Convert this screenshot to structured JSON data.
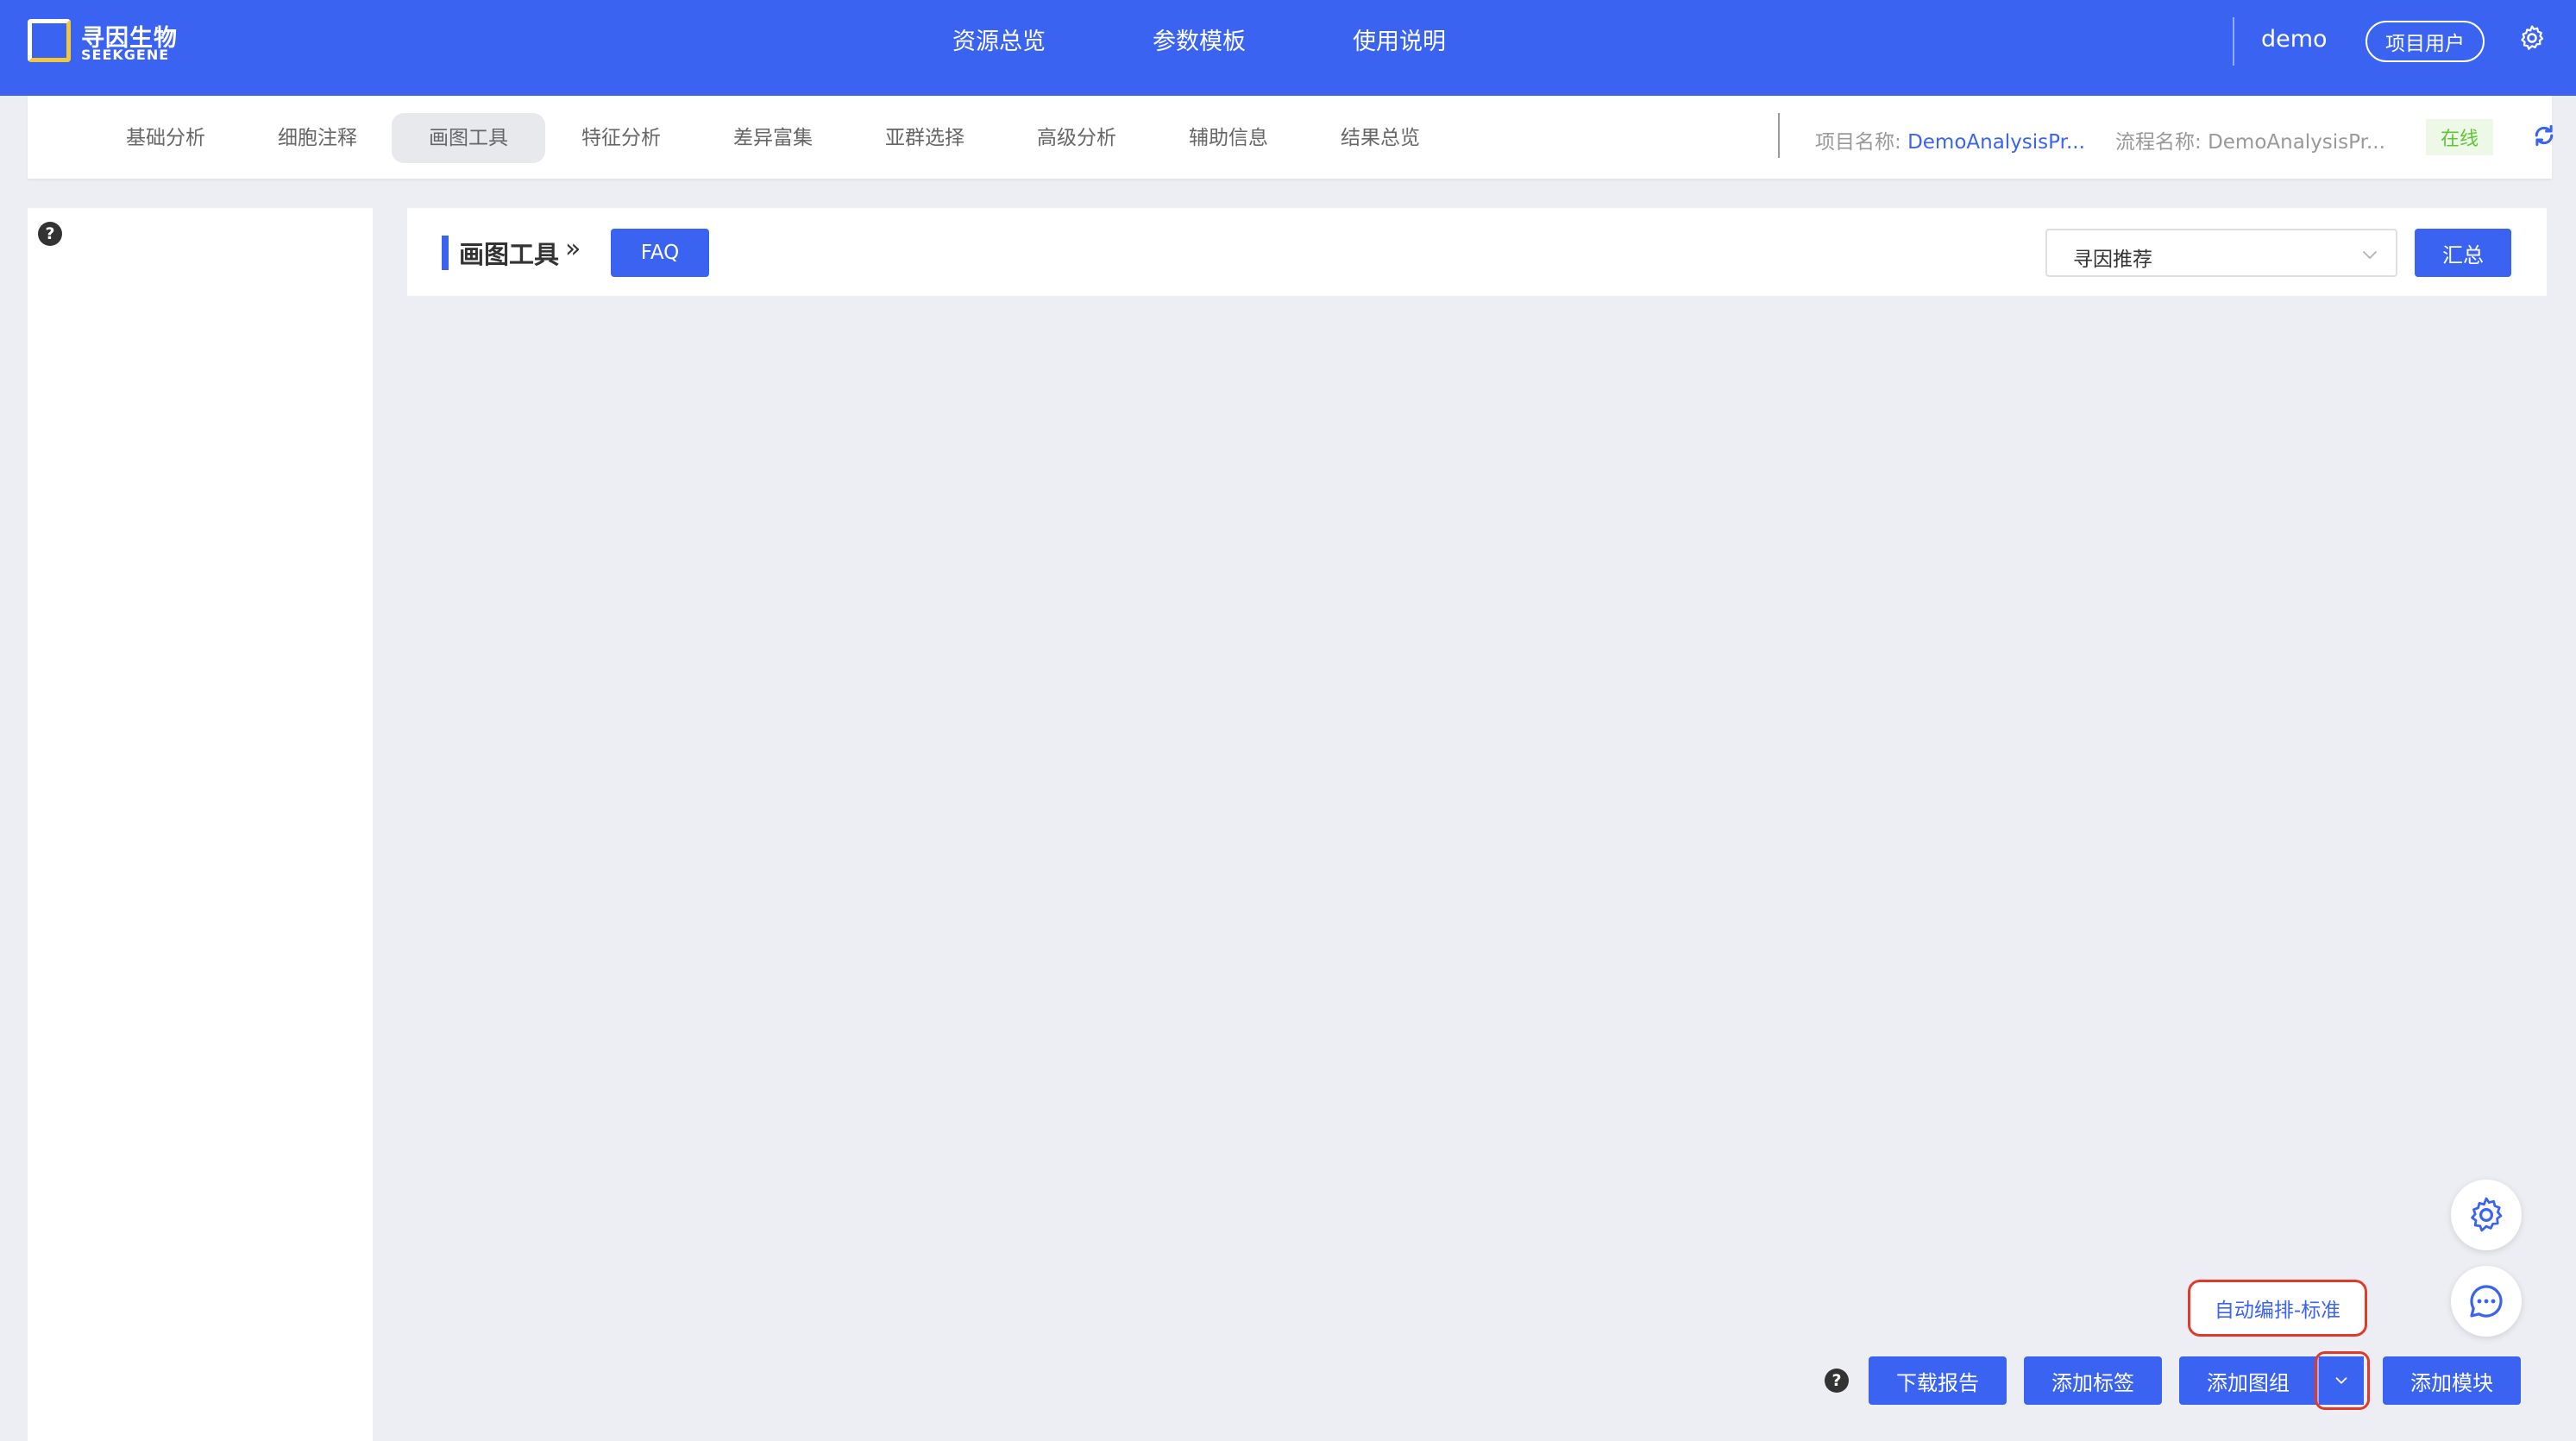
{
  "header": {
    "logo": {
      "cn": "寻因生物",
      "en": "SEEKGENE"
    },
    "nav": [
      "资源总览",
      "参数模板",
      "使用说明"
    ],
    "username": "demo",
    "role_label": "项目用户",
    "settings_icon": "gear-icon"
  },
  "subnav": {
    "tabs": [
      "基础分析",
      "细胞注释",
      "画图工具",
      "特征分析",
      "差异富集",
      "亚群选择",
      "高级分析",
      "辅助信息",
      "结果总览"
    ],
    "active_tab": "画图工具",
    "project_label": "项目名称:",
    "project_value": "DemoAnalysisPr...",
    "flow_label": "流程名称:",
    "flow_value": "DemoAnalysisPr...",
    "status": "在线",
    "status_color": "#62c33a",
    "refresh_icon": "refresh-icon"
  },
  "sidebar": {
    "help_icon": "?"
  },
  "toolbar": {
    "title": "画图工具",
    "chevron": "»",
    "faq_label": "FAQ",
    "select_value": "寻因推荐",
    "summary_label": "汇总"
  },
  "floating": {
    "settings_icon": "gear-icon",
    "chat_icon": "chat-icon"
  },
  "actions": {
    "help_icon": "?",
    "download_label": "下载报告",
    "add_tag_label": "添加标签",
    "add_group_label": "添加图组",
    "add_module_label": "添加模块",
    "dropdown_option": "自动编排-标准"
  },
  "colors": {
    "primary": "#3a63f2",
    "highlight": "#e03a2c",
    "background": "#eceef3"
  }
}
